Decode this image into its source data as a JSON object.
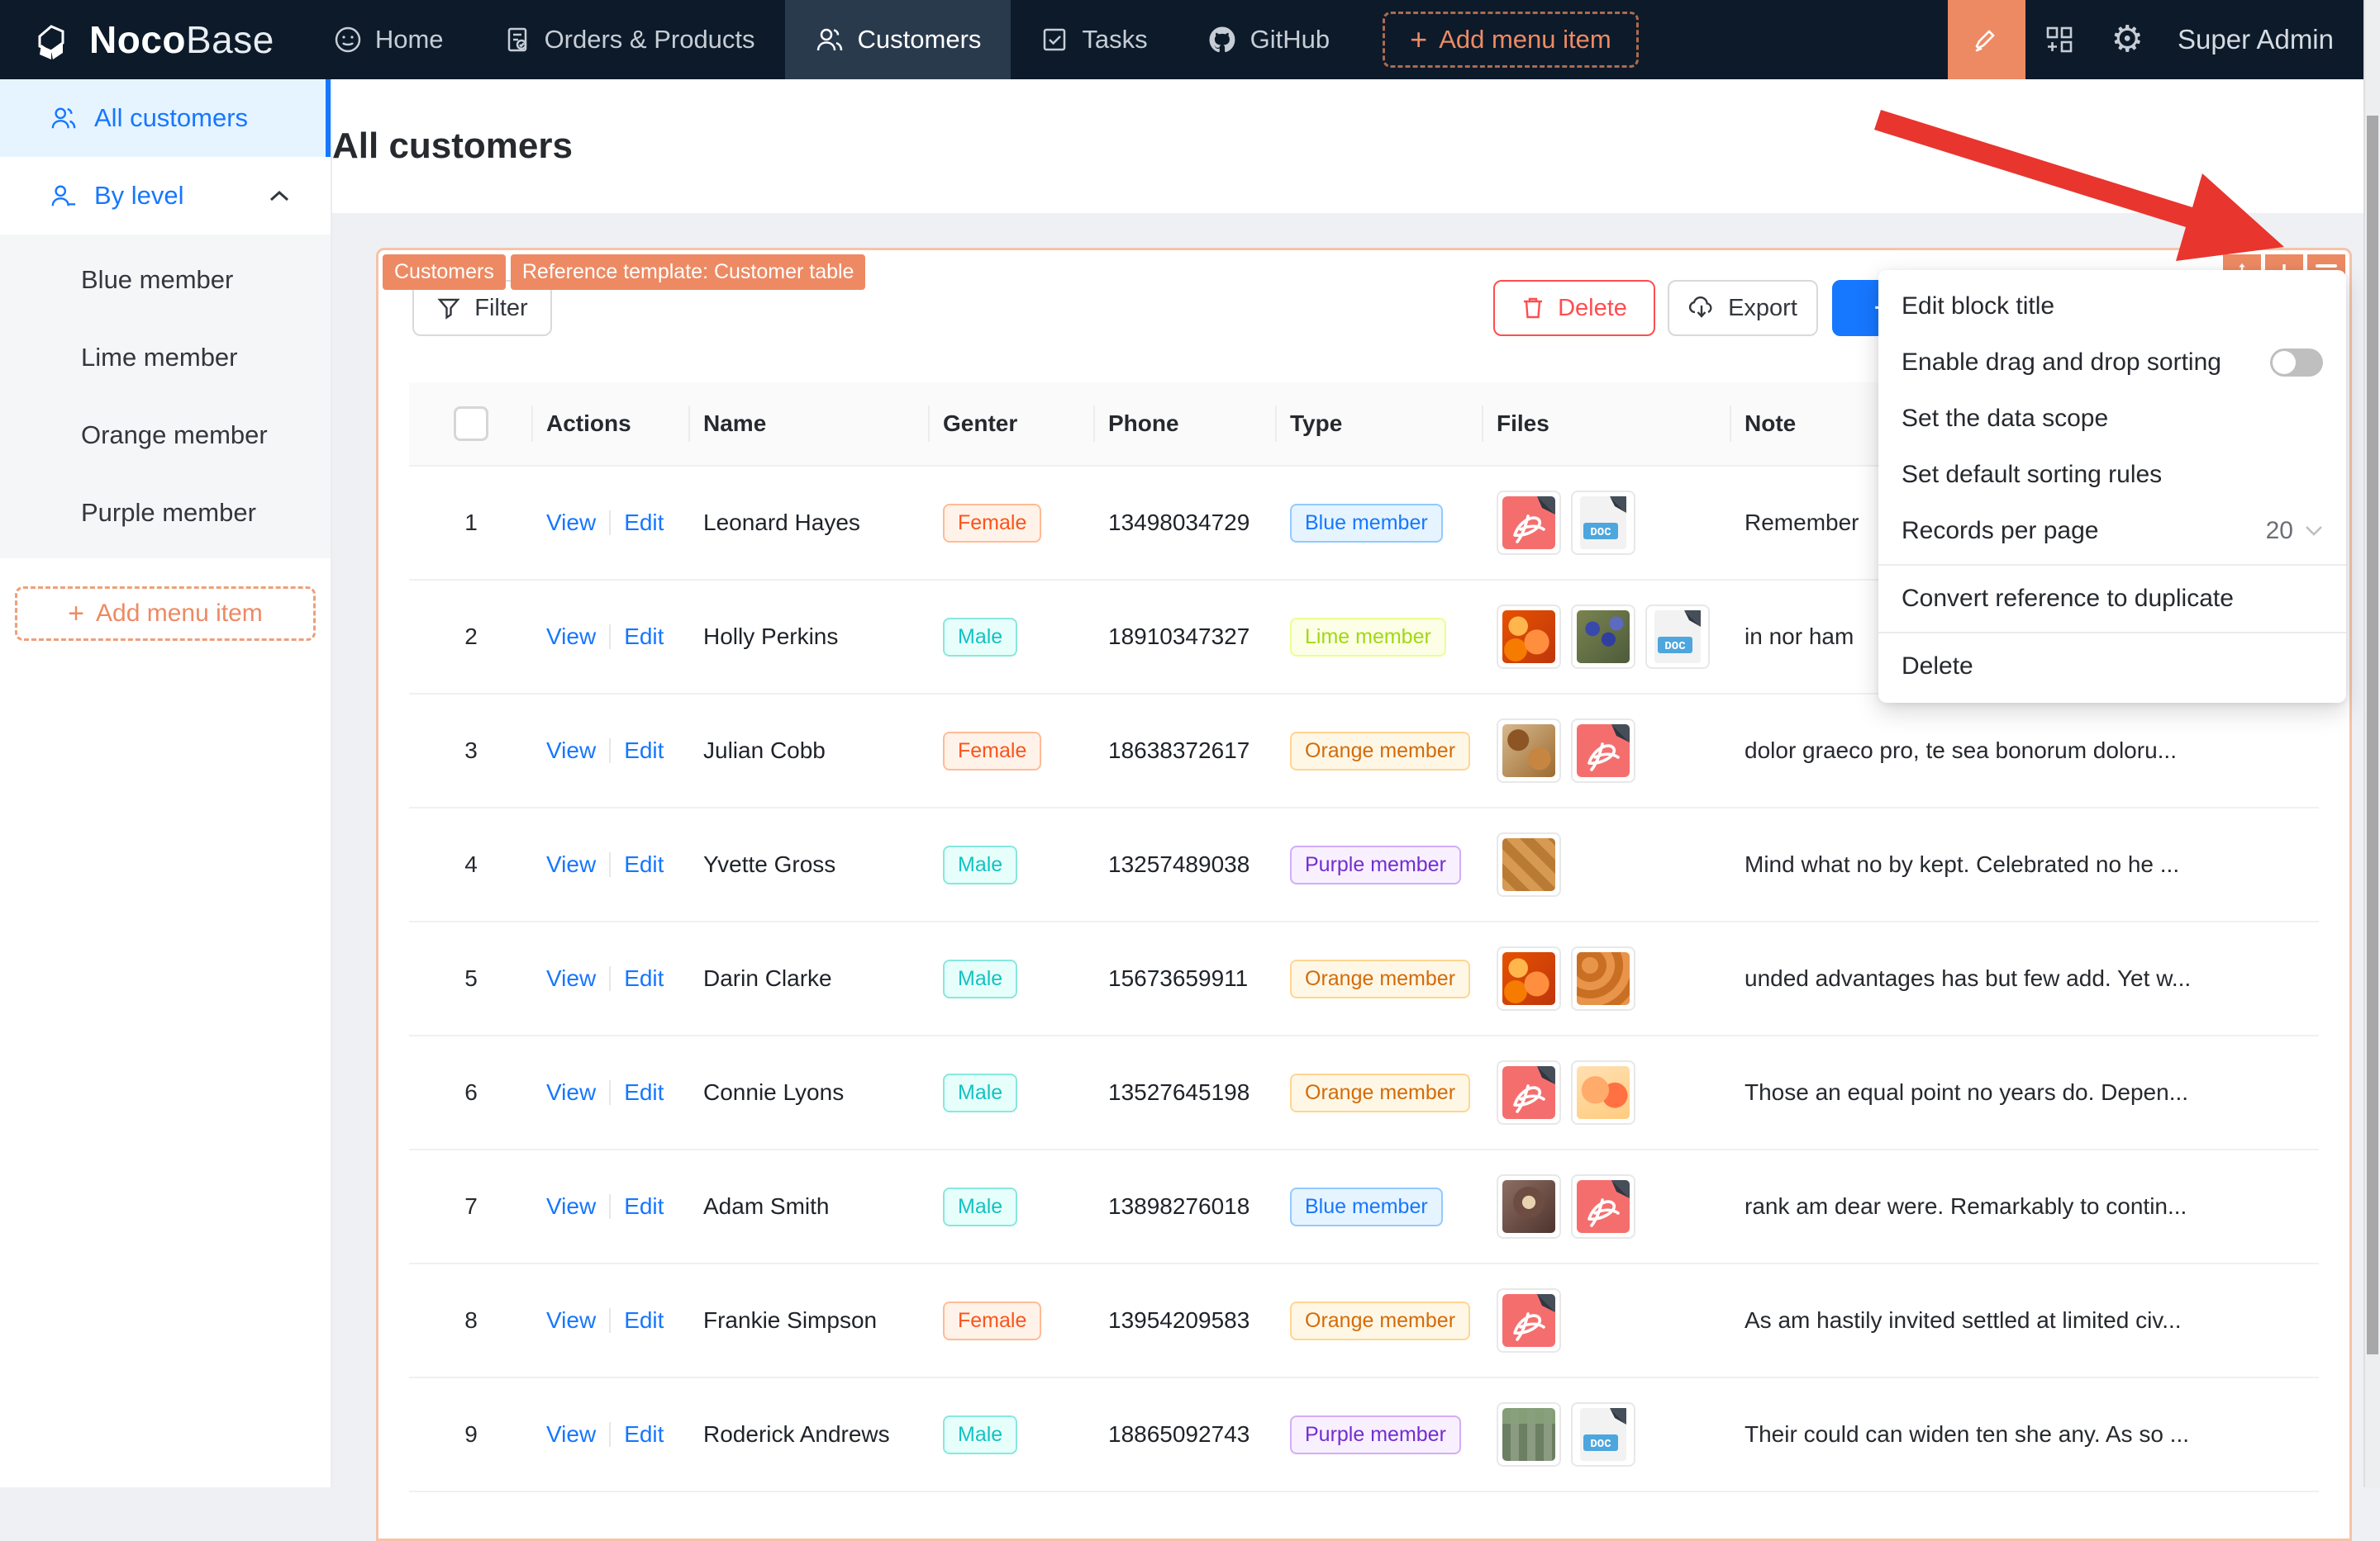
{
  "nav": {
    "brand_bold": "Noco",
    "brand_light": "Base",
    "items": [
      {
        "label": "Home"
      },
      {
        "label": "Orders & Products"
      },
      {
        "label": "Customers"
      },
      {
        "label": "Tasks"
      },
      {
        "label": "GitHub"
      }
    ],
    "add_menu_item_label": "Add menu item",
    "user": "Super Admin"
  },
  "sidebar": {
    "all_customers": "All customers",
    "by_level": "By level",
    "children": [
      "Blue member",
      "Lime member",
      "Orange member",
      "Purple member"
    ],
    "add_menu_item_label": "Add menu item"
  },
  "page": {
    "title": "All customers"
  },
  "block": {
    "tags": [
      "Customers",
      "Reference template: Customer table"
    ],
    "toolbar": {
      "filter": "Filter",
      "delete": "Delete",
      "export": "Export",
      "add": "+"
    },
    "designer_menu": {
      "edit_block_title": "Edit block title",
      "enable_drag": "Enable drag and drop sorting",
      "drag_toggle_state": "off",
      "set_data_scope": "Set the data scope",
      "set_sorting_rules": "Set default sorting rules",
      "records_per_page": "Records per page",
      "records_per_page_value": "20",
      "convert_reference": "Convert reference to duplicate",
      "delete": "Delete"
    },
    "table": {
      "headers": {
        "actions": "Actions",
        "name": "Name",
        "gender": "Genter",
        "phone": "Phone",
        "type": "Type",
        "files": "Files",
        "note": "Note"
      },
      "action_view": "View",
      "action_edit": "Edit",
      "rows": [
        {
          "index": "1",
          "name": "Leonard Hayes",
          "gender": "Female",
          "gender_color": "volcano",
          "phone": "13498034729",
          "type": "Blue member",
          "type_color": "blue",
          "files": [
            "pdf",
            "doc"
          ],
          "note": "Remember"
        },
        {
          "index": "2",
          "name": "Holly Perkins",
          "gender": "Male",
          "gender_color": "cyan",
          "phone": "18910347327",
          "type": "Lime member",
          "type_color": "lime",
          "files": [
            "img-oranges",
            "img-berries",
            "doc"
          ],
          "note": "in nor ham"
        },
        {
          "index": "3",
          "name": "Julian Cobb",
          "gender": "Female",
          "gender_color": "volcano",
          "phone": "18638372617",
          "type": "Orange member",
          "type_color": "orange",
          "files": [
            "img-food",
            "pdf"
          ],
          "note": "dolor graeco pro, te sea bonorum doloru..."
        },
        {
          "index": "4",
          "name": "Yvette Gross",
          "gender": "Male",
          "gender_color": "cyan",
          "phone": "13257489038",
          "type": "Purple member",
          "type_color": "purple",
          "files": [
            "img-bread"
          ],
          "note": "Mind what no by kept. Celebrated no he ..."
        },
        {
          "index": "5",
          "name": "Darin Clarke",
          "gender": "Male",
          "gender_color": "cyan",
          "phone": "15673659911",
          "type": "Orange member",
          "type_color": "orange",
          "files": [
            "img-oranges",
            "img-crate"
          ],
          "note": "unded advantages has but few add. Yet w..."
        },
        {
          "index": "6",
          "name": "Connie Lyons",
          "gender": "Male",
          "gender_color": "cyan",
          "phone": "13527645198",
          "type": "Orange member",
          "type_color": "orange",
          "files": [
            "pdf",
            "img-peaches"
          ],
          "note": "Those an equal point no years do. Depen..."
        },
        {
          "index": "7",
          "name": "Adam Smith",
          "gender": "Male",
          "gender_color": "cyan",
          "phone": "13898276018",
          "type": "Blue member",
          "type_color": "blue",
          "files": [
            "img-coffee",
            "pdf"
          ],
          "note": "rank am dear were. Remarkably to contin..."
        },
        {
          "index": "8",
          "name": "Frankie Simpson",
          "gender": "Female",
          "gender_color": "volcano",
          "phone": "13954209583",
          "type": "Orange member",
          "type_color": "orange",
          "files": [
            "pdf"
          ],
          "note": "As am hastily invited settled at limited civ..."
        },
        {
          "index": "9",
          "name": "Roderick Andrews",
          "gender": "Male",
          "gender_color": "cyan",
          "phone": "18865092743",
          "type": "Purple member",
          "type_color": "purple",
          "files": [
            "img-shop",
            "doc"
          ],
          "note": "Their could can widen ten she any. As so ..."
        }
      ]
    }
  },
  "colors": {
    "accent_orange": "#ed8a63",
    "nav_bg": "#0c1a2a",
    "primary_blue": "#1677ff",
    "arrow_red": "#e8352e",
    "danger_red": "#ff4d4f"
  }
}
